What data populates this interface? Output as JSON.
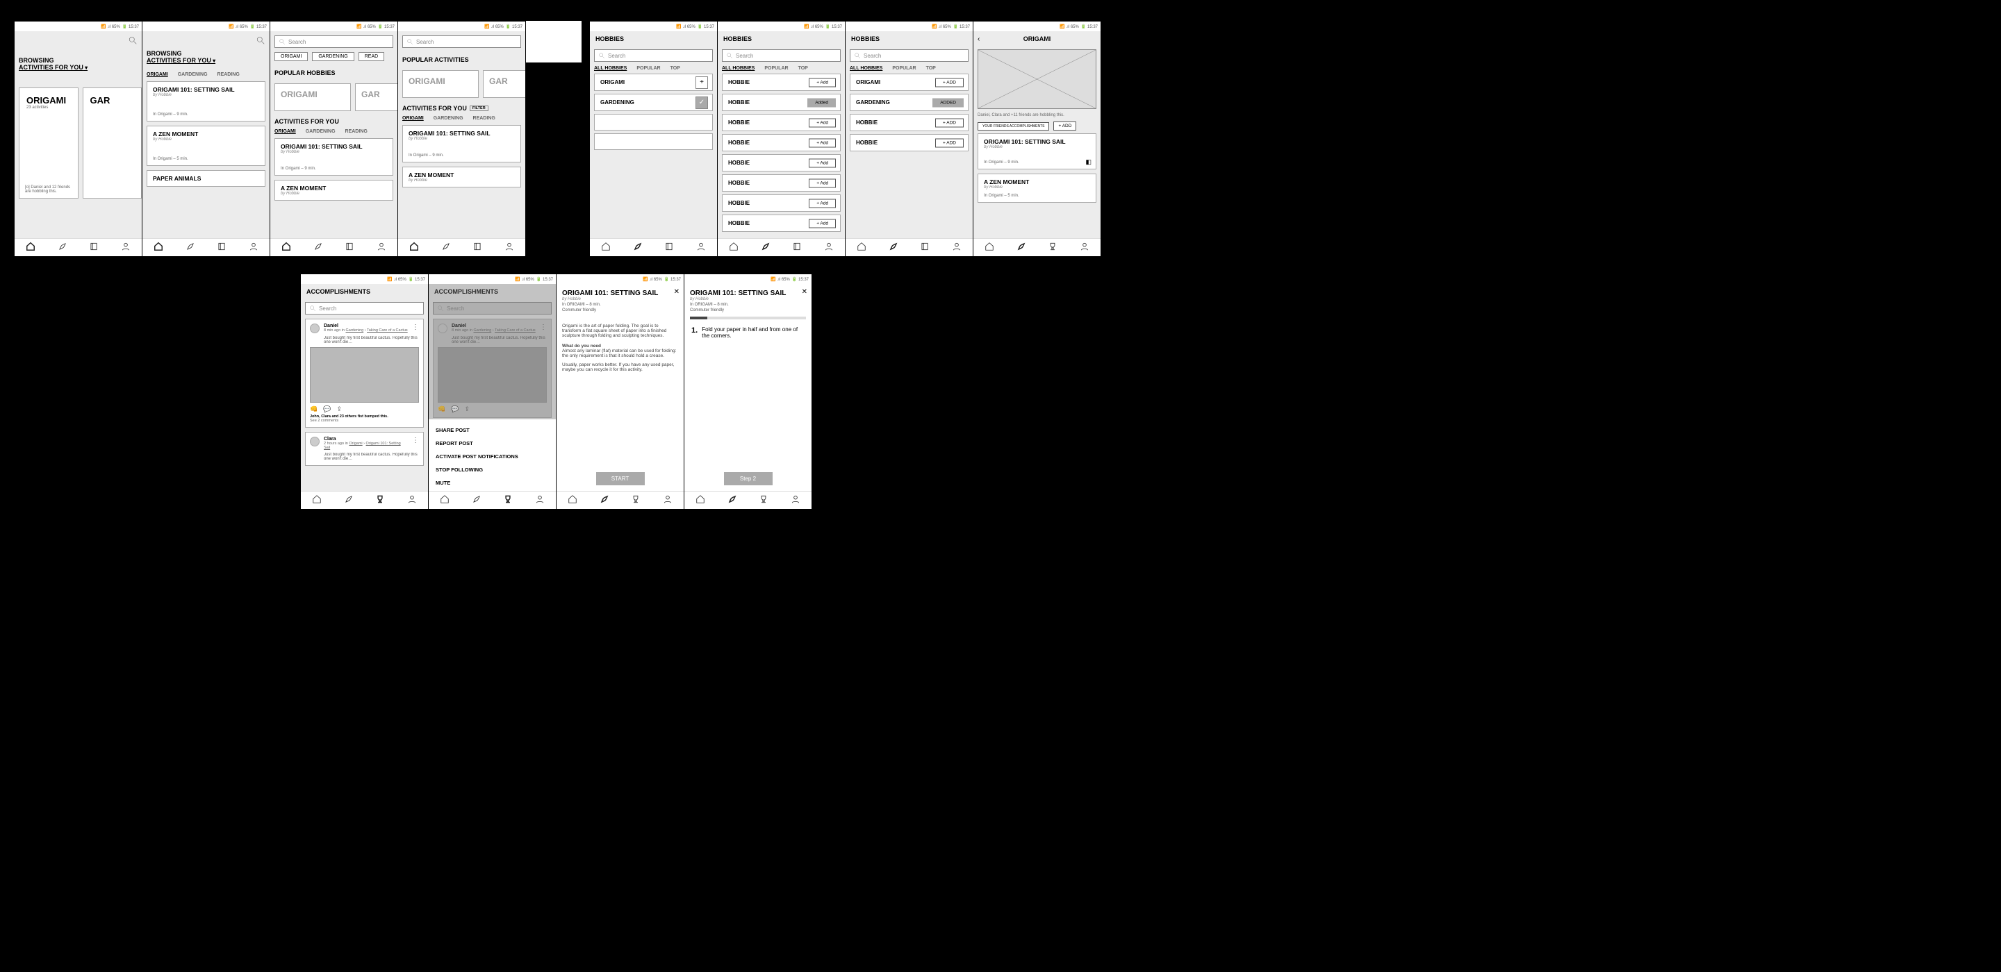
{
  "status": {
    "signal": "📶 .ıl 65%",
    "batt": "🔋 15:37"
  },
  "nav": {
    "home": "home",
    "rocket": "rocket",
    "book": "book",
    "user": "user",
    "trophy": "trophy"
  },
  "common": {
    "search_ph": "Search",
    "browsing": "BROWSING",
    "afy": "ACTIVITIES FOR YOU",
    "hobbies": "HOBBIES",
    "all_hobbies": "ALL HOBBIES",
    "popular": "POPULAR",
    "top": "TOP",
    "pop_act": "POPULAR ACTIVITIES",
    "pop_hob": "POPULAR HOBBIES",
    "filter": "FILTER",
    "add": "+ Add",
    "add_caps": "+ ADD",
    "added": "Added",
    "added_caps": "ADDED",
    "by_hobbie": "by Hobbie"
  },
  "hobby_tabs": [
    "ORIGAMI",
    "GARDENING",
    "READING"
  ],
  "cards": {
    "origami_hero": "ORIGAMI",
    "origami_count": "23 activities",
    "origami_friends": "[o] Daniel and 12 friends are hobbling this.",
    "gar_hero": "GAR",
    "sail": "ORIGAMI 101: SETTING SAIL",
    "sail_meta9": "In Origami – 9 min.",
    "sail_meta5": "In Origami – 5 min.",
    "zen": "A ZEN MOMENT",
    "animals": "PAPER ANIMALS"
  },
  "hobbies_list": {
    "origami": "ORIGAMI",
    "gardening": "GARDENING",
    "hobbie": "HOBBIE"
  },
  "origami_page": {
    "title": "ORIGAMI",
    "friends": "Daniel, Clara and +11 friends are hobbling this.",
    "friends_btn": "YOUR FRIENDS ACCOMPLISHMENTS",
    "add_btn": "+ ADD",
    "m1": "In Origami – 9 min.",
    "m2": "In Origami – 5 min."
  },
  "accomp": {
    "title": "ACCOMPLISHMENTS",
    "daniel": "Daniel",
    "daniel_meta_1": "8 min ago in ",
    "daniel_meta_link1": "Gardening",
    "daniel_meta_sep": " › ",
    "daniel_meta_link2": "Taking Care of a Cactus",
    "daniel_body": "Just bought my first beautiful cactus. Hopefully this one won't die…",
    "likes": "John, Clara and 23 others fist bumped this.",
    "comments": "See 2 comments",
    "clara": "Clara",
    "clara_meta_1": "2 hours ago in ",
    "clara_meta_link1": "Origami",
    "clara_meta_link2": "Origami 101: Setting Sail"
  },
  "sheet": {
    "share": "SHARE POST",
    "report": "REPORT POST",
    "notif": "ACTIVATE POST NOTIFICATIONS",
    "stop": "STOP FOLLOWING",
    "mute": "MUTE"
  },
  "detail": {
    "title": "ORIGAMI 101: SETTING SAIL",
    "by": "by Hobbie",
    "meta1": "In ORIGAMI – 8 min.",
    "meta2": "Commuter friendly",
    "p1": "Origami is the art of paper folding. The goal is to transform a flat square sheet of paper into a finished sculpture through folding and sculpting techniques.",
    "need_h": "What do you need",
    "p2": "Almost any laminar (flat) material can be used for folding: the only requirement is that it should hold a crease.",
    "p3": "Usually, paper works better. If you have any used paper, maybe you can recycle it for this activity.",
    "start": "START",
    "step_n": "1.",
    "step_t": "Fold your paper in half and from one of the corners.",
    "step2": "Step 2"
  }
}
